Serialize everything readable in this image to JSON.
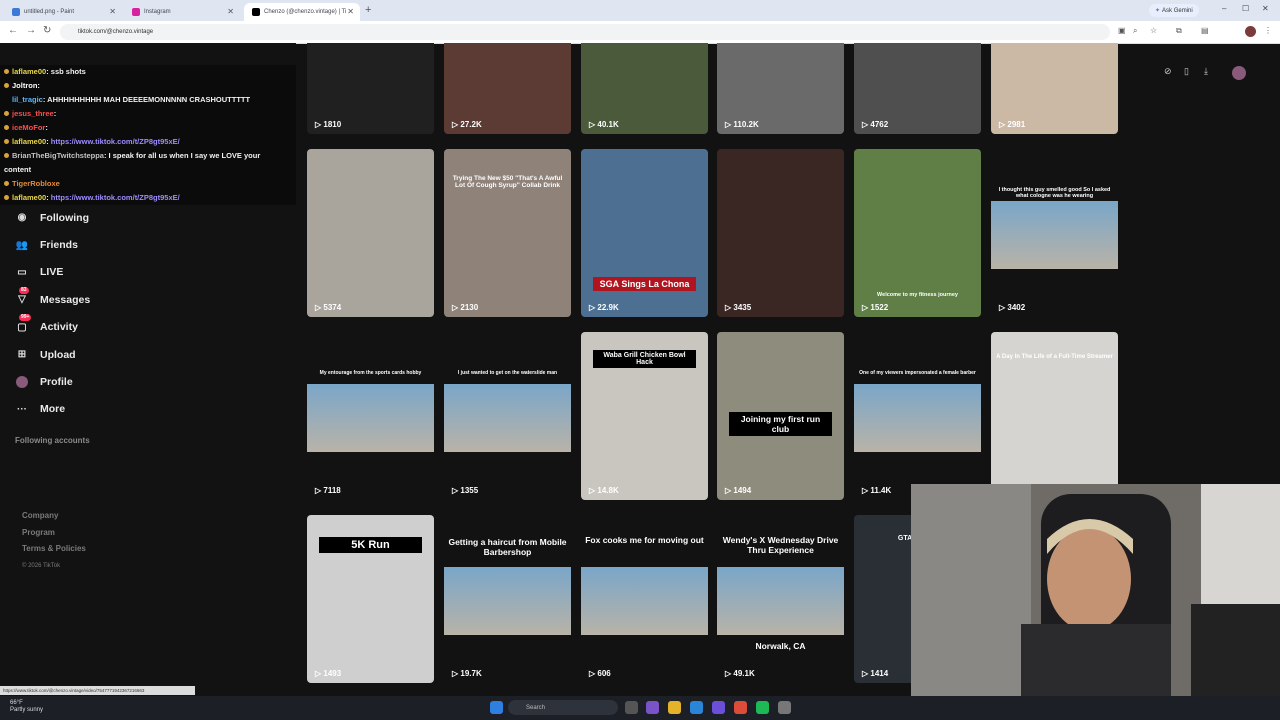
{
  "browser": {
    "tabs": [
      {
        "title": "untitled.png - Paint",
        "active": false
      },
      {
        "title": "Instagram",
        "active": false
      },
      {
        "title": "Chenzo (@chenzo.vintage) | Ti",
        "active": true
      }
    ],
    "ask_gemini": "Ask Gemini",
    "url": "tiktok.com/@chenzo.vintage"
  },
  "chat": [
    {
      "user": "laflame00",
      "msg": ": ssb shots"
    },
    {
      "user": "Joltron",
      "msg": ":"
    },
    {
      "user": "lil_tragic",
      "msg": ": AHHHHHHHHH MAH DEEEEMONNNNN CRASHOUTTTTT"
    },
    {
      "user": "jesus_three",
      "msg": ":"
    },
    {
      "user": "iceMoFor",
      "msg": ":"
    },
    {
      "user": "laflame00",
      "msg": ":",
      "link": "https://www.tiktok.com/t/ZP8gt95xE/"
    },
    {
      "user": "BrianTheBigTwitchsteppa",
      "msg": ": I speak for all us when I say we LOVE your"
    },
    {
      "user": "",
      "msg": "content"
    },
    {
      "user": "TigerRobloxe",
      "msg": ""
    },
    {
      "user": "laflame00",
      "msg": ":",
      "link": "https://www.tiktok.com/t/ZP8gt95xE/"
    }
  ],
  "sidebar": {
    "items": [
      {
        "label": "Following",
        "icon": "following-icon"
      },
      {
        "label": "Friends",
        "icon": "friends-icon"
      },
      {
        "label": "LIVE",
        "icon": "live-icon"
      },
      {
        "label": "Messages",
        "icon": "messages-icon",
        "badge": "83"
      },
      {
        "label": "Activity",
        "icon": "activity-icon",
        "badge": "99+"
      },
      {
        "label": "Upload",
        "icon": "upload-icon"
      },
      {
        "label": "Profile",
        "icon": "profile-icon"
      },
      {
        "label": "More",
        "icon": "more-icon"
      }
    ],
    "following_accounts": "Following accounts",
    "footer": [
      "Company",
      "Program",
      "Terms & Policies"
    ],
    "copyright": "© 2026 TikTok"
  },
  "videos": [
    {
      "views": "1810",
      "caption": "",
      "bg": "#202020"
    },
    {
      "views": "27.2K",
      "caption": "",
      "bg": "#5b3b34"
    },
    {
      "views": "40.1K",
      "caption": "",
      "bg": "#4a5a3a"
    },
    {
      "views": "110.2K",
      "caption": "",
      "bg": "#6a6a6a"
    },
    {
      "views": "4762",
      "caption": "",
      "bg": "#4f4f4f"
    },
    {
      "views": "2981",
      "caption": "",
      "bg": "#cbb9a6"
    },
    {
      "views": "5374",
      "caption": "",
      "bg": "#a9a49c"
    },
    {
      "views": "2130",
      "caption": "Trying The New $50 \"That's A Awful Lot Of Cough Syrup\" Collab Drink",
      "bg": "#8e8279"
    },
    {
      "views": "22.9K",
      "caption": "SGA Sings La Chona",
      "bg": "#4d6f92"
    },
    {
      "views": "3435",
      "caption": "",
      "bg": "#3a2622"
    },
    {
      "views": "1522",
      "caption": "Welcome to my fitness journey",
      "bg": "#5f7f46"
    },
    {
      "views": "3402",
      "caption": "I thought this guy smelled good So I asked what cologne was he wearing",
      "bg": "#121212"
    },
    {
      "views": "7118",
      "caption": "My entourage from the sports cards hobby",
      "bg": "#121212"
    },
    {
      "views": "1355",
      "caption": "I just wanted to get on the waterslide man",
      "bg": "#121212"
    },
    {
      "views": "14.8K",
      "caption": "Waba Grill Chicken Bowl Hack",
      "bg": "#c9c6c0"
    },
    {
      "views": "1494",
      "caption": "Joining my first run club",
      "bg": "#8e8c7c"
    },
    {
      "views": "11.4K",
      "caption": "One of my viewers impersonated a female barber",
      "bg": "#121212"
    },
    {
      "views": "",
      "caption": "A Day In The Life of a Full-Time Streamer",
      "bg": "#d6d4d0"
    },
    {
      "views": "1493",
      "caption": "5K Run",
      "bg": "#cfcfcf"
    },
    {
      "views": "19.7K",
      "caption": "Getting a haircut from Mobile Barbershop",
      "bg": "#121212"
    },
    {
      "views": "606",
      "caption": "Fox cooks me for moving out",
      "bg": "#121212"
    },
    {
      "views": "49.1K",
      "caption": "Wendy's X Wednesday Drive Thru Experience",
      "bg": "#121212",
      "subcaption": "Norwalk, CA"
    },
    {
      "views": "1414",
      "caption": "GTA Vice Ci",
      "bg": "#2a2f36"
    }
  ],
  "status_url": "https://www.tiktok.com/@chenzo.vintage/video/7547771942367216663",
  "taskbar": {
    "weather_temp": "66°F",
    "weather_text": "Partly sunny",
    "search": "Search"
  }
}
